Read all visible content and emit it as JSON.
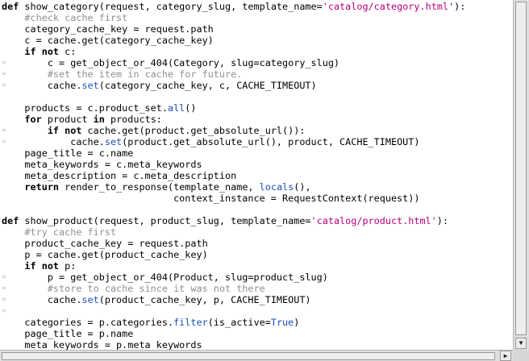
{
  "editor": {
    "lines": [
      {
        "wrap": false,
        "tokens": [
          {
            "t": "def",
            "c": "kw"
          },
          {
            "t": " show_category(request, category_slug, template_name=",
            "c": ""
          },
          {
            "t": "'catalog/category.html'",
            "c": "str"
          },
          {
            "t": "):",
            "c": ""
          }
        ]
      },
      {
        "wrap": false,
        "tokens": [
          {
            "t": "    ",
            "c": ""
          },
          {
            "t": "#check cache first",
            "c": "cm"
          }
        ]
      },
      {
        "wrap": false,
        "tokens": [
          {
            "t": "    category_cache_key = request.path",
            "c": ""
          }
        ]
      },
      {
        "wrap": false,
        "tokens": [
          {
            "t": "    c = cache.get(category_cache_key)",
            "c": ""
          }
        ]
      },
      {
        "wrap": false,
        "tokens": [
          {
            "t": "    ",
            "c": ""
          },
          {
            "t": "if not",
            "c": "kw"
          },
          {
            "t": " c:",
            "c": ""
          }
        ]
      },
      {
        "wrap": true,
        "tokens": [
          {
            "t": "        c = get_object_or_404(Category, slug=category_slug)",
            "c": ""
          }
        ]
      },
      {
        "wrap": true,
        "tokens": [
          {
            "t": "        ",
            "c": ""
          },
          {
            "t": "#set the item in cache for future.",
            "c": "cm"
          }
        ]
      },
      {
        "wrap": true,
        "tokens": [
          {
            "t": "        cache.",
            "c": ""
          },
          {
            "t": "set",
            "c": "bi"
          },
          {
            "t": "(category_cache_key, c, CACHE_TIMEOUT)",
            "c": ""
          }
        ]
      },
      {
        "wrap": false,
        "tokens": []
      },
      {
        "wrap": false,
        "tokens": [
          {
            "t": "    products = c.product_set.",
            "c": ""
          },
          {
            "t": "all",
            "c": "bi"
          },
          {
            "t": "()",
            "c": ""
          }
        ]
      },
      {
        "wrap": false,
        "tokens": [
          {
            "t": "    ",
            "c": ""
          },
          {
            "t": "for",
            "c": "kw"
          },
          {
            "t": " product ",
            "c": ""
          },
          {
            "t": "in",
            "c": "kw"
          },
          {
            "t": " products:",
            "c": ""
          }
        ]
      },
      {
        "wrap": true,
        "tokens": [
          {
            "t": "        ",
            "c": ""
          },
          {
            "t": "if not",
            "c": "kw"
          },
          {
            "t": " cache.get(product.get_absolute_url()):",
            "c": ""
          }
        ]
      },
      {
        "wrap": true,
        "tokens": [
          {
            "t": "            cache.",
            "c": ""
          },
          {
            "t": "set",
            "c": "bi"
          },
          {
            "t": "(product.get_absolute_url(), product, CACHE_TIMEOUT)",
            "c": ""
          }
        ]
      },
      {
        "wrap": false,
        "tokens": [
          {
            "t": "    page_title = c.name",
            "c": ""
          }
        ]
      },
      {
        "wrap": false,
        "tokens": [
          {
            "t": "    meta_keywords = c.meta_keywords",
            "c": ""
          }
        ]
      },
      {
        "wrap": false,
        "tokens": [
          {
            "t": "    meta_description = c.meta_description",
            "c": ""
          }
        ]
      },
      {
        "wrap": false,
        "tokens": [
          {
            "t": "    ",
            "c": ""
          },
          {
            "t": "return",
            "c": "kw"
          },
          {
            "t": " render_to_response(template_name, ",
            "c": ""
          },
          {
            "t": "locals",
            "c": "bi"
          },
          {
            "t": "(),",
            "c": ""
          }
        ]
      },
      {
        "wrap": false,
        "tokens": [
          {
            "t": "                              context_instance = RequestContext(request))",
            "c": ""
          }
        ]
      },
      {
        "wrap": false,
        "tokens": []
      },
      {
        "wrap": false,
        "tokens": [
          {
            "t": "def",
            "c": "kw"
          },
          {
            "t": " show_product(request, product_slug, template_name=",
            "c": ""
          },
          {
            "t": "'catalog/product.html'",
            "c": "str"
          },
          {
            "t": "):",
            "c": ""
          }
        ]
      },
      {
        "wrap": false,
        "tokens": [
          {
            "t": "    ",
            "c": ""
          },
          {
            "t": "#try cache first",
            "c": "cm"
          }
        ]
      },
      {
        "wrap": false,
        "tokens": [
          {
            "t": "    product_cache_key = request.path",
            "c": ""
          }
        ]
      },
      {
        "wrap": false,
        "tokens": [
          {
            "t": "    p = cache.get(product_cache_key)",
            "c": ""
          }
        ]
      },
      {
        "wrap": false,
        "tokens": [
          {
            "t": "    ",
            "c": ""
          },
          {
            "t": "if not",
            "c": "kw"
          },
          {
            "t": " p:",
            "c": ""
          }
        ]
      },
      {
        "wrap": true,
        "tokens": [
          {
            "t": "        p = get_object_or_404(Product, slug=product_slug)",
            "c": ""
          }
        ]
      },
      {
        "wrap": true,
        "tokens": [
          {
            "t": "        ",
            "c": ""
          },
          {
            "t": "#store to cache since it was not there",
            "c": "cm"
          }
        ]
      },
      {
        "wrap": true,
        "tokens": [
          {
            "t": "        cache.",
            "c": ""
          },
          {
            "t": "set",
            "c": "bi"
          },
          {
            "t": "(product_cache_key, p, CACHE_TIMEOUT)",
            "c": ""
          }
        ]
      },
      {
        "wrap": true,
        "tokens": []
      },
      {
        "wrap": false,
        "tokens": [
          {
            "t": "    categories = p.categories.",
            "c": ""
          },
          {
            "t": "filter",
            "c": "bi"
          },
          {
            "t": "(is_active=",
            "c": ""
          },
          {
            "t": "True",
            "c": "bi"
          },
          {
            "t": ")",
            "c": ""
          }
        ]
      },
      {
        "wrap": false,
        "tokens": [
          {
            "t": "    page_title = p.name",
            "c": ""
          }
        ]
      },
      {
        "wrap": false,
        "tokens": [
          {
            "t": "    meta_keywords = p.meta_keywords",
            "c": ""
          }
        ]
      }
    ]
  },
  "colors": {
    "keyword": "#000000",
    "string": "#b5007a",
    "comment": "#8f8f8f",
    "builtin": "#1f4fb8",
    "wrap_marker": "#b8b8b8"
  },
  "icons": {
    "wrap_marker": "wrap-marker-icon",
    "scroll_down": "arrow-down-icon",
    "scroll_right": "arrow-right-icon"
  }
}
